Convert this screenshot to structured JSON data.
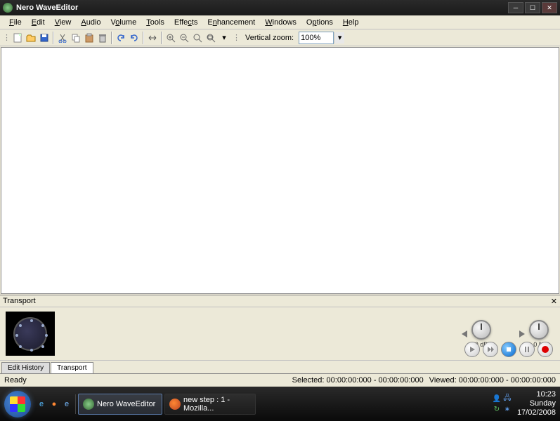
{
  "titlebar": {
    "app": "Nero WaveEditor"
  },
  "menu": {
    "file": "File",
    "edit": "Edit",
    "view": "View",
    "audio": "Audio",
    "volume": "Volume",
    "tools": "Tools",
    "effects": "Effects",
    "enhancement": "Enhancement",
    "windows": "Windows",
    "options": "Options",
    "help": "Help"
  },
  "toolbar": {
    "zoom_label": "Vertical zoom:",
    "zoom_value": "100%"
  },
  "transport": {
    "title": "Transport",
    "tabs": {
      "edit_history": "Edit History",
      "transport": "Transport"
    },
    "db_knob": "0 dB",
    "pct_knob": "0 %"
  },
  "statusbar": {
    "ready": "Ready",
    "selected": "Selected: 00:00:00:000 - 00:00:00:000",
    "viewed": "Viewed: 00:00:00:000 - 00:00:00:000"
  },
  "taskbar": {
    "app1": "Nero WaveEditor",
    "app2": "new step : 1 - Mozilla...",
    "time": "10:23",
    "day": "Sunday",
    "date": "17/02/2008"
  }
}
